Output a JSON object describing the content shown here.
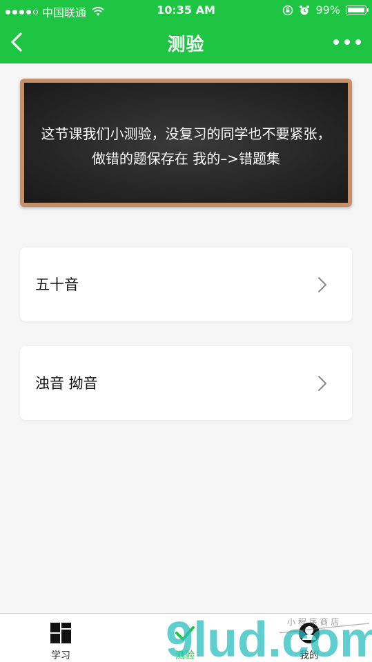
{
  "status_bar": {
    "carrier": "中国联通",
    "time": "10:35 AM",
    "battery": "99%"
  },
  "nav": {
    "title": "测验"
  },
  "board": {
    "message": "这节课我们小测验，没复习的同学也不要紧张，做错的题保存在 我的–>错题集"
  },
  "quiz_list": [
    {
      "label": "五十音"
    },
    {
      "label": "浊音 拗音"
    }
  ],
  "tab_bar": {
    "tabs": [
      {
        "label": "学习",
        "icon": "grid-icon"
      },
      {
        "label": "测验",
        "icon": "checkmark-icon"
      },
      {
        "label": "我的",
        "icon": "user-icon"
      }
    ]
  },
  "watermark": {
    "text": "9lud.com",
    "subtext": "小 程 序 商 店"
  },
  "colors": {
    "primary": "#1ec542",
    "board_frame": "#c4906a",
    "board_bg": "#262626"
  }
}
